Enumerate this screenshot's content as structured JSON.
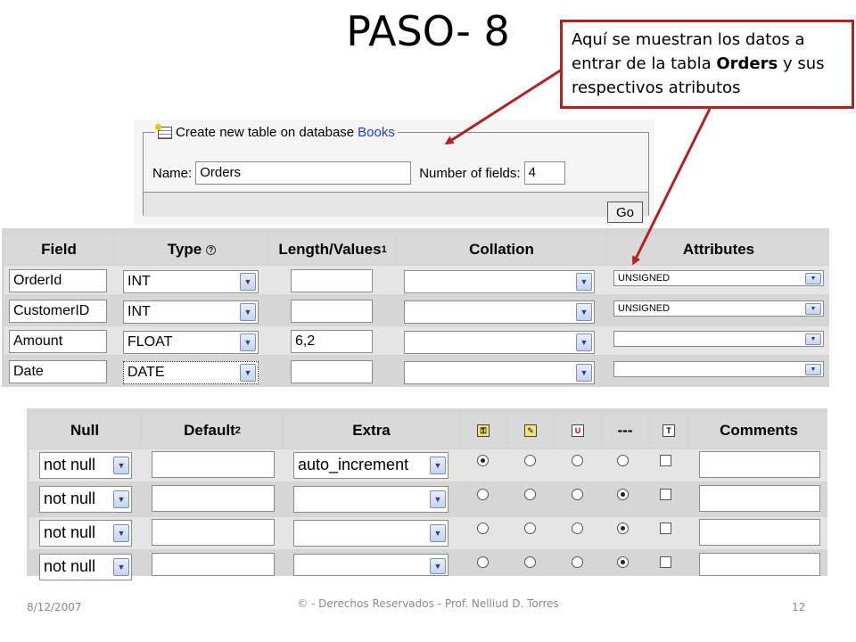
{
  "slide": {
    "title": "PASO- 8",
    "callout_pre": "Aquí se muestran los datos a entrar de la tabla ",
    "callout_bold": "Orders",
    "callout_post": " y sus respectivos atributos"
  },
  "create_table": {
    "legend_label": "Create new table on database",
    "database": "Books",
    "name_label": "Name:",
    "name_value": "Orders",
    "fields_label": "Number of fields:",
    "fields_value": "4",
    "go_label": "Go"
  },
  "fields_table": {
    "headers": {
      "field": "Field",
      "type": "Type",
      "length": "Length/Values",
      "length_sup": "1",
      "collation": "Collation",
      "attributes": "Attributes"
    },
    "rows": [
      {
        "field": "OrderId",
        "type": "INT",
        "length": "",
        "collation": "",
        "attributes": "UNSIGNED"
      },
      {
        "field": "CustomerID",
        "type": "INT",
        "length": "",
        "collation": "",
        "attributes": "UNSIGNED"
      },
      {
        "field": "Amount",
        "type": "FLOAT",
        "length": "6,2",
        "collation": "",
        "attributes": ""
      },
      {
        "field": "Date",
        "type": "DATE",
        "length": "",
        "collation": "",
        "attributes": ""
      }
    ]
  },
  "options_table": {
    "headers": {
      "null": "Null",
      "default": "Default",
      "default_sup": "2",
      "extra": "Extra",
      "none": "---",
      "comments": "Comments"
    },
    "rows": [
      {
        "null": "not null",
        "default": "",
        "extra": "auto_increment",
        "selected_index": 0,
        "fulltext": false,
        "comment": ""
      },
      {
        "null": "not null",
        "default": "",
        "extra": "",
        "selected_index": 3,
        "fulltext": false,
        "comment": ""
      },
      {
        "null": "not null",
        "default": "",
        "extra": "",
        "selected_index": 3,
        "fulltext": false,
        "comment": ""
      },
      {
        "null": "not null",
        "default": "",
        "extra": "",
        "selected_index": 3,
        "fulltext": false,
        "comment": ""
      }
    ]
  },
  "footer": {
    "date": "8/12/2007",
    "copyright": "© - Derechos Reservados - Prof. Nelliud D. Torres",
    "page": "12"
  },
  "colors": {
    "callout_border": "#b22222",
    "database_link": "#1a3bd1"
  },
  "icons": [
    "primary-key-icon",
    "index-icon",
    "unique-icon",
    "fulltext-icon",
    "help-icon",
    "table-icon"
  ]
}
